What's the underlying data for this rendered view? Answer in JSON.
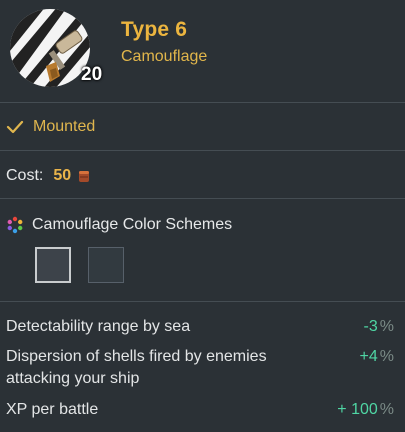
{
  "header": {
    "title": "Type 6",
    "subtitle": "Camouflage",
    "badge": "20",
    "icon": "camouflage-paint-icon"
  },
  "status": {
    "label": "Mounted",
    "icon": "checkmark-icon"
  },
  "cost": {
    "label": "Cost:",
    "value": "50",
    "icon": "coal-icon"
  },
  "schemes": {
    "title": "Camouflage Color Schemes",
    "icon": "color-wheel-icon",
    "swatches": [
      {
        "color": "#3d434a",
        "selected": true
      },
      {
        "color": "#323a40",
        "selected": false
      }
    ]
  },
  "stats": [
    {
      "label": "Detectability range by sea",
      "value": "-3",
      "unit": "%"
    },
    {
      "label": "Dispersion of shells fired by enemies attacking your ship",
      "label_line1": "Dispersion of shells fired by enemies",
      "label_line2": "attacking your ship",
      "value": "+4",
      "unit": "%"
    },
    {
      "label": "XP per battle",
      "value": "+ 100",
      "unit": "%"
    }
  ],
  "colors": {
    "accent": "#ecb53f",
    "positive": "#4fd6a4",
    "background": "#2b3136"
  }
}
